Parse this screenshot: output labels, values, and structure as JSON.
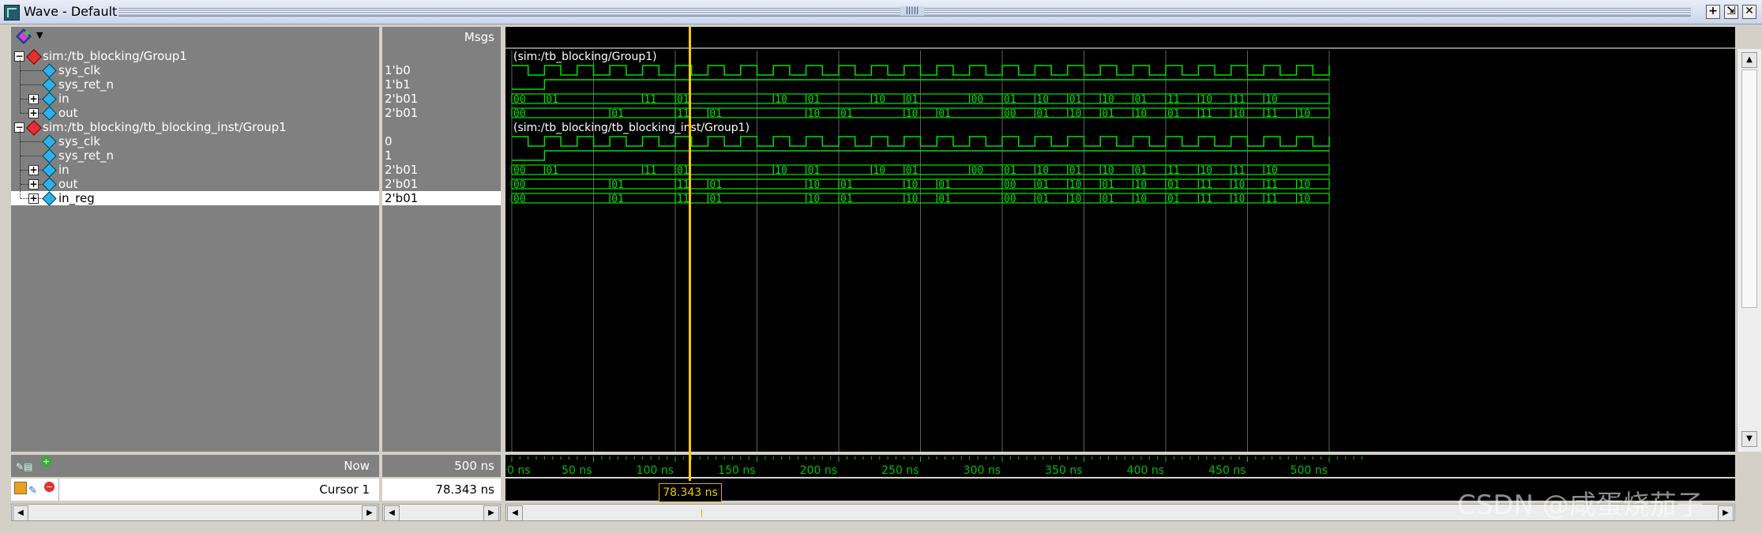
{
  "window": {
    "title": "Wave - Default",
    "buttons": [
      "+",
      "⇲",
      "✕"
    ]
  },
  "values_header": "Msgs",
  "signals": [
    {
      "kind": "group",
      "label": "sim:/tb_blocking/Group1",
      "value": "",
      "indent": 0
    },
    {
      "kind": "signal",
      "label": "sys_clk",
      "value": "1'b0",
      "indent": 1
    },
    {
      "kind": "signal",
      "label": "sys_ret_n",
      "value": "1'b1",
      "indent": 1
    },
    {
      "kind": "bus",
      "label": "in",
      "value": "2'b01",
      "indent": 1
    },
    {
      "kind": "bus",
      "label": "out",
      "value": "2'b01",
      "indent": 1
    },
    {
      "kind": "group",
      "label": "sim:/tb_blocking/tb_blocking_inst/Group1",
      "value": "",
      "indent": 0
    },
    {
      "kind": "signal",
      "label": "sys_clk",
      "value": "0",
      "indent": 1
    },
    {
      "kind": "signal",
      "label": "sys_ret_n",
      "value": "1",
      "indent": 1
    },
    {
      "kind": "bus",
      "label": "in",
      "value": "2'b01",
      "indent": 1
    },
    {
      "kind": "bus",
      "label": "out",
      "value": "2'b01",
      "indent": 1
    },
    {
      "kind": "bus",
      "label": "in_reg",
      "value": "2'b01",
      "indent": 1,
      "selected": true
    }
  ],
  "group_banners": [
    "(sim:/tb_blocking/Group1)",
    "(sim:/tb_blocking/tb_blocking_inst/Group1)"
  ],
  "waves": {
    "in": [
      {
        "t0": 0,
        "t1": 20,
        "v": "00"
      },
      {
        "t0": 20,
        "t1": 80,
        "v": "01"
      },
      {
        "t0": 80,
        "t1": 100,
        "v": "11"
      },
      {
        "t0": 100,
        "t1": 160,
        "v": "01"
      },
      {
        "t0": 160,
        "t1": 180,
        "v": "10"
      },
      {
        "t0": 180,
        "t1": 220,
        "v": "01"
      },
      {
        "t0": 220,
        "t1": 240,
        "v": "10"
      },
      {
        "t0": 240,
        "t1": 280,
        "v": "01"
      },
      {
        "t0": 280,
        "t1": 300,
        "v": "00"
      },
      {
        "t0": 300,
        "t1": 320,
        "v": "01"
      },
      {
        "t0": 320,
        "t1": 340,
        "v": "10"
      },
      {
        "t0": 340,
        "t1": 360,
        "v": "01"
      },
      {
        "t0": 360,
        "t1": 380,
        "v": "10"
      },
      {
        "t0": 380,
        "t1": 400,
        "v": "01"
      },
      {
        "t0": 400,
        "t1": 420,
        "v": "11"
      },
      {
        "t0": 420,
        "t1": 440,
        "v": "10"
      },
      {
        "t0": 440,
        "t1": 460,
        "v": "11"
      },
      {
        "t0": 460,
        "t1": 500,
        "v": "10"
      }
    ],
    "out": [
      {
        "t0": 0,
        "t1": 60,
        "v": "00"
      },
      {
        "t0": 60,
        "t1": 100,
        "v": "01"
      },
      {
        "t0": 100,
        "t1": 120,
        "v": "11"
      },
      {
        "t0": 120,
        "t1": 180,
        "v": "01"
      },
      {
        "t0": 180,
        "t1": 200,
        "v": "10"
      },
      {
        "t0": 200,
        "t1": 240,
        "v": "01"
      },
      {
        "t0": 240,
        "t1": 260,
        "v": "10"
      },
      {
        "t0": 260,
        "t1": 300,
        "v": "01"
      },
      {
        "t0": 300,
        "t1": 320,
        "v": "00"
      },
      {
        "t0": 320,
        "t1": 340,
        "v": "01"
      },
      {
        "t0": 340,
        "t1": 360,
        "v": "10"
      },
      {
        "t0": 360,
        "t1": 380,
        "v": "01"
      },
      {
        "t0": 380,
        "t1": 400,
        "v": "10"
      },
      {
        "t0": 400,
        "t1": 420,
        "v": "01"
      },
      {
        "t0": 420,
        "t1": 440,
        "v": "11"
      },
      {
        "t0": 440,
        "t1": 460,
        "v": "10"
      },
      {
        "t0": 460,
        "t1": 480,
        "v": "11"
      },
      {
        "t0": 480,
        "t1": 500,
        "v": "10"
      }
    ],
    "reset_release_ns": 20,
    "clk_period_ns": 20,
    "timeline_end_ns": 500
  },
  "axis": {
    "ticks": [
      "0 ns",
      "50 ns",
      "100 ns",
      "150 ns",
      "200 ns",
      "250 ns",
      "300 ns",
      "350 ns",
      "400 ns",
      "450 ns",
      "500 ns"
    ],
    "tick_values": [
      0,
      50,
      100,
      150,
      200,
      250,
      300,
      350,
      400,
      450,
      500
    ]
  },
  "status": {
    "now_label": "Now",
    "now_value": "500 ns",
    "cursor_label": "Cursor 1",
    "cursor_value": "78.343 ns",
    "cursor_ns": 78.343,
    "cursor_flag": "78.343 ns"
  },
  "watermark": "CSDN @咸蛋烧茄子",
  "colors": {
    "wave": "#00e000",
    "cursor": "#ffcc00",
    "grid": "#606060",
    "background": "#000000"
  }
}
